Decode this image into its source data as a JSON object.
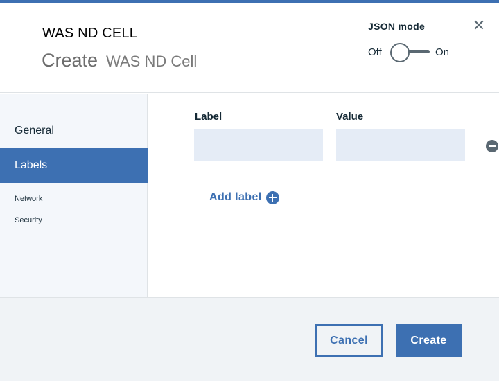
{
  "modal": {
    "label": "WAS ND CELL",
    "heading_verb": "Create",
    "heading_kind": "WAS ND Cell",
    "close_icon": "close-icon"
  },
  "json_mode": {
    "title": "JSON mode",
    "off_label": "Off",
    "on_label": "On",
    "enabled": false
  },
  "sidebar": {
    "items": [
      {
        "label": "General",
        "active": false
      },
      {
        "label": "Labels",
        "active": true
      },
      {
        "label": "Network",
        "active": false
      },
      {
        "label": "Security",
        "active": false
      }
    ]
  },
  "labels_form": {
    "label_header": "Label",
    "value_header": "Value",
    "rows": [
      {
        "label": "",
        "value": "",
        "remove_icon": "minus-circle-icon"
      }
    ],
    "add_label_text": "Add label",
    "add_icon": "plus-circle-icon"
  },
  "footer": {
    "cancel_label": "Cancel",
    "create_label": "Create"
  },
  "colors": {
    "accent": "#3d70b2",
    "field_bg": "#e5ecf6",
    "sidebar_bg": "#f4f7fb",
    "footer_bg": "#f0f3f6",
    "icon_gray": "#5a6872"
  }
}
